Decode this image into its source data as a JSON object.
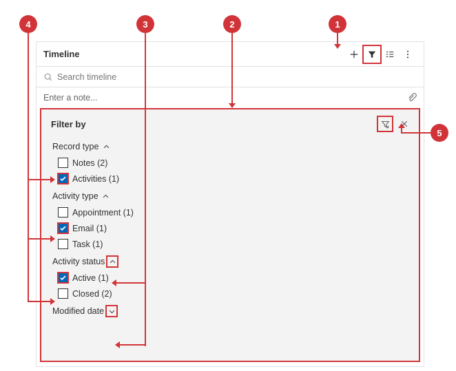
{
  "header": {
    "title": "Timeline"
  },
  "search": {
    "placeholder": "Search timeline"
  },
  "note": {
    "placeholder": "Enter a note..."
  },
  "panel": {
    "title": "Filter by",
    "groups": [
      {
        "label": "Record type",
        "expanded": true,
        "options": [
          {
            "label": "Notes (2)",
            "checked": false
          },
          {
            "label": "Activities (1)",
            "checked": true
          }
        ]
      },
      {
        "label": "Activity type",
        "expanded": true,
        "options": [
          {
            "label": "Appointment (1)",
            "checked": false
          },
          {
            "label": "Email (1)",
            "checked": true
          },
          {
            "label": "Task (1)",
            "checked": false
          }
        ]
      },
      {
        "label": "Activity status",
        "expanded": true,
        "options": [
          {
            "label": "Active (1)",
            "checked": true
          },
          {
            "label": "Closed (2)",
            "checked": false
          }
        ]
      },
      {
        "label": "Modified date",
        "expanded": false,
        "options": []
      }
    ]
  },
  "callouts": {
    "c1": "1",
    "c2": "2",
    "c3": "3",
    "c4": "4",
    "c5": "5"
  }
}
